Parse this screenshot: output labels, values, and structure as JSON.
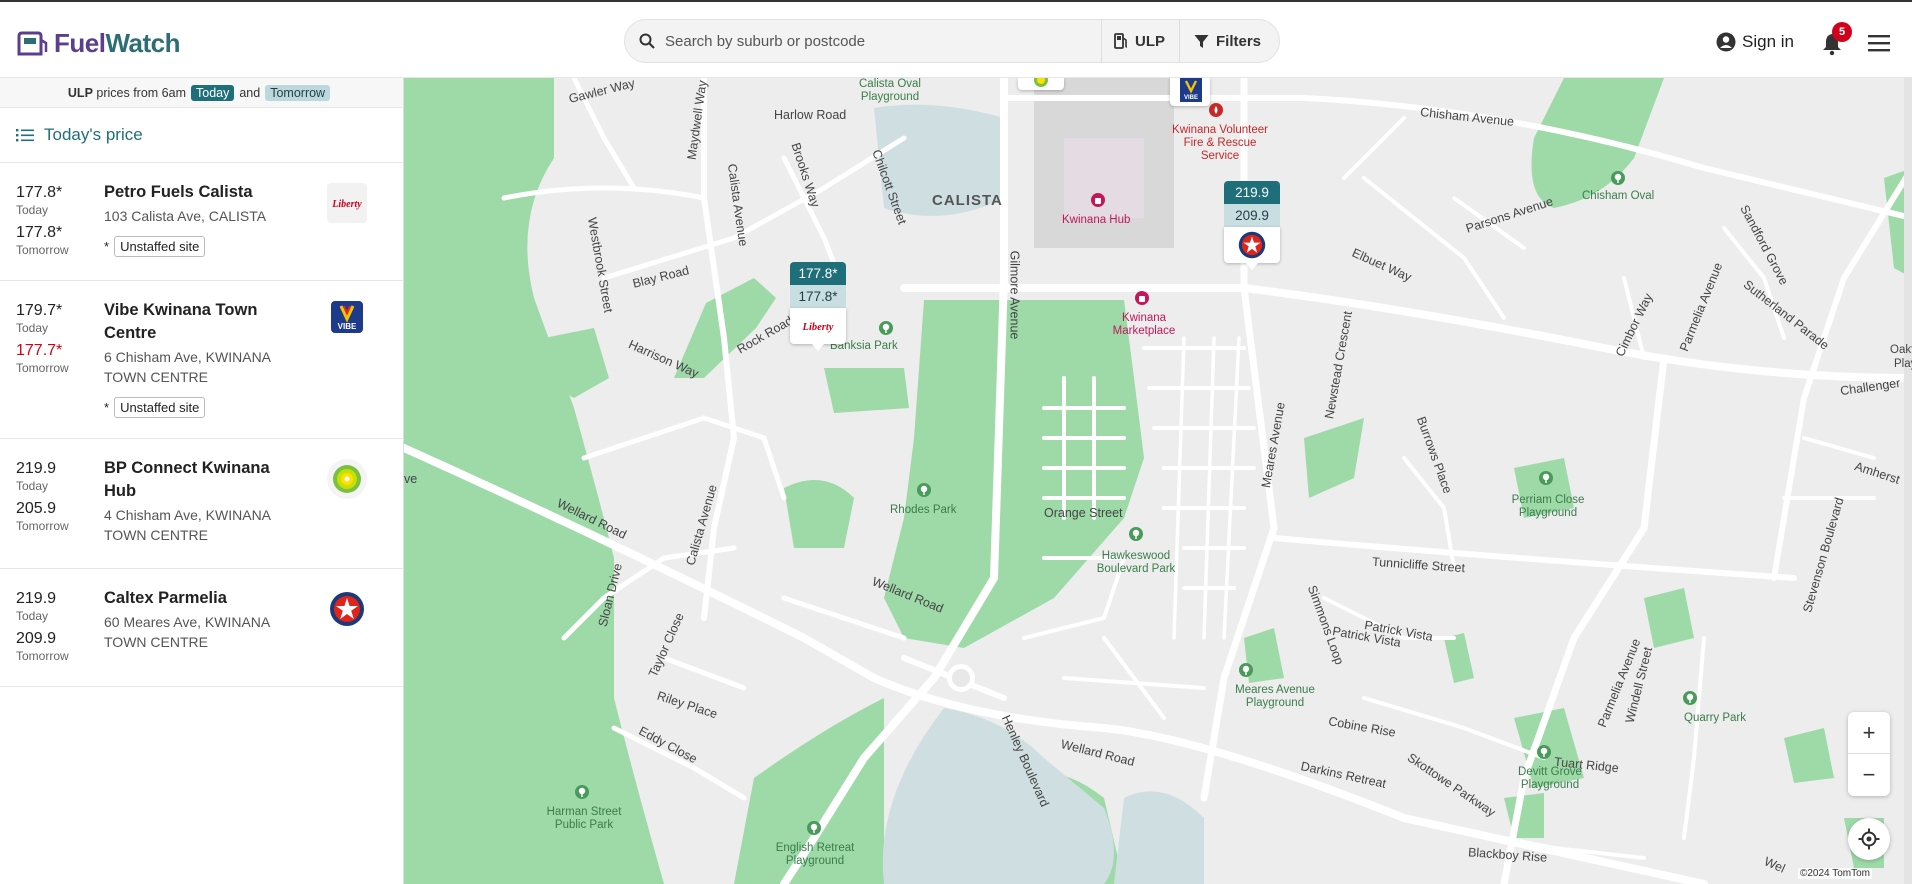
{
  "header": {
    "logo_text_fuel": "Fuel",
    "logo_text_watch": "Watch",
    "search_placeholder": "Search by suburb or postcode",
    "fuel_type": "ULP",
    "filters_label": "Filters",
    "signin_label": "Sign in",
    "notification_count": "5",
    "icons": [
      "fuelwatch-logo-icon",
      "search-icon",
      "fuel-pump-icon",
      "filter-icon",
      "user-icon",
      "bell-icon",
      "menu-icon"
    ]
  },
  "sidebar": {
    "banner": {
      "fuel": "ULP",
      "text": "prices from 6am",
      "today": "Today",
      "and": "and",
      "tomorrow": "Tomorrow"
    },
    "sort_label": "Today's price",
    "stations": [
      {
        "price_today": "177.8*",
        "today_label": "Today",
        "price_tomorrow": "177.8*",
        "tomorrow_label": "Tomorrow",
        "name": "Petro Fuels Calista",
        "address": "103 Calista Ave, CALISTA",
        "tag_mark": "*",
        "tag": "Unstaffed site",
        "brand": "Liberty"
      },
      {
        "price_today": "179.7*",
        "today_label": "Today",
        "price_tomorrow": "177.7*",
        "tomorrow_label": "Tomorrow",
        "name": "Vibe Kwinana Town Centre",
        "address": "6 Chisham Ave, KWINANA TOWN CENTRE",
        "tag_mark": "*",
        "tag": "Unstaffed site",
        "brand": "VIBE"
      },
      {
        "price_today": "219.9",
        "today_label": "Today",
        "price_tomorrow": "205.9",
        "tomorrow_label": "Tomorrow",
        "name": "BP Connect Kwinana Hub",
        "address": "4 Chisham Ave, KWINANA TOWN CENTRE",
        "brand": "BP"
      },
      {
        "price_today": "219.9",
        "today_label": "Today",
        "price_tomorrow": "209.9",
        "tomorrow_label": "Tomorrow",
        "name": "Caltex Parmelia",
        "address": "60 Meares Ave, KWINANA TOWN CENTRE",
        "brand": "Caltex"
      }
    ]
  },
  "map": {
    "suburb": "CALISTA",
    "streets": [
      "Gawler Way",
      "Harlow Road",
      "Maydwell Way",
      "Brooks Way",
      "Chilcott Street",
      "Calista Avenue",
      "Blay Road",
      "Westbrook Street",
      "Harrison Way",
      "Gilmore Avenue",
      "Chisham Avenue",
      "Parsons Avenue",
      "Elbuet Way",
      "Newstead Crescent",
      "Cimbor Way",
      "Parmelia Avenue",
      "Sutherland Parade",
      "Sandford Grove",
      "Challenger",
      "Amherst",
      "Orange Street",
      "Meares Avenue",
      "Burrows Place",
      "Tunnicliffe Street",
      "Stevenson Boulevard",
      "Wellard Road",
      "Sloan Drive",
      "Taylor Close",
      "Riley Place",
      "Eddy Close",
      "Henley Boulevard",
      "Simmons Loop",
      "Patrick Vista",
      "Cobine Rise",
      "Darkins Retreat",
      "Skottowe Parkway",
      "Tuart Ridge",
      "Windell Street",
      "Blackboy Rise",
      "ve",
      "Calista Avenue",
      "Wellard Road",
      "Wellard Road",
      "Parmelia Avenue",
      "Patrick Vista"
    ],
    "parks": [
      "Calista Oval Playground",
      "Banksia Park",
      "Rhodes Park",
      "Hawkeswood Boulevard Park",
      "Chisham Oval",
      "Perriam Close Playground",
      "Meares Avenue Playground",
      "Devitt Grove Playground",
      "Quarry Park",
      "Harman Street Public Park",
      "English Retreat Playground",
      "Rock Road"
    ],
    "pois": [
      "Kwinana Hub",
      "Kwinana Marketplace"
    ],
    "fire_station": "Kwinana Volunteer Fire & Rescue Service",
    "edge_labels": [
      "Oakfiel",
      "Play"
    ],
    "road_partial": "Wel",
    "markers": [
      {
        "brand": "Liberty",
        "today": "177.8*",
        "tomorrow": "177.8*"
      },
      {
        "brand": "Caltex",
        "today": "219.9",
        "tomorrow": "209.9"
      }
    ],
    "zoom_in": "+",
    "zoom_out": "−",
    "attribution": "©2024 TomTom"
  },
  "colors": {
    "teal": "#1f6f7a",
    "teal_light": "#c8dee1",
    "park_green": "#9ed9a8",
    "water": "#cfdfe1",
    "road": "#ffffff",
    "alert_red": "#d0021b",
    "logo_purple": "#5b3f8c"
  }
}
